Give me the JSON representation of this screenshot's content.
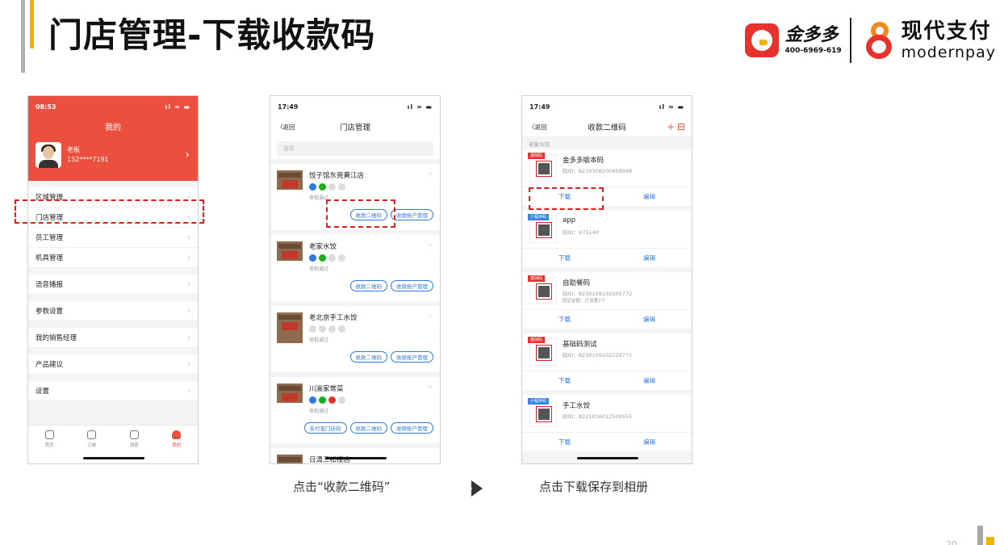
{
  "slide": {
    "title": "门店管理-下载收款码",
    "page_number": "20"
  },
  "brand": {
    "jdd_name": "金多多",
    "jdd_phone": "400-6969-619",
    "mp_cn": "现代支付",
    "mp_en": "modernpay"
  },
  "phone_me": {
    "time": "08:53",
    "sys": "ıl ≈ ▬",
    "title": "我的",
    "user_name": "老板",
    "user_phone": "152****7191",
    "menu": [
      "区域管理",
      "门店管理",
      "员工管理",
      "机具管理",
      "语音播报",
      "参数设置",
      "我的销售经理",
      "产品建议",
      "设置"
    ],
    "tabs": [
      "首页",
      "订单",
      "消息",
      "我的"
    ]
  },
  "phone_stores": {
    "time": "17:49",
    "sys": "ıl ≈ ▬",
    "back": "〈返回",
    "title": "门店管理",
    "search_placeholder": "搜索",
    "stores": [
      {
        "name": "饺子馆东莞黄江店",
        "status": "审批通过",
        "btn_qr": "收款二维码",
        "btn_account": "收款账户管理"
      },
      {
        "name": "老家水饺",
        "status": "审批通过",
        "btn_qr": "收款二维码",
        "btn_account": "收款账户管理"
      },
      {
        "name": "老北京手工水饺",
        "status": "审批通过",
        "btn_qr": "收款二维码",
        "btn_account": "收款账户管理"
      },
      {
        "name": "川渝家常菜",
        "status": "审批通过",
        "btn_alipay": "支付宝门店码",
        "btn_qr": "收款二维码",
        "btn_account": "收款账户管理"
      },
      {
        "name": "日清三松楼店"
      }
    ]
  },
  "phone_qr": {
    "time": "17:49",
    "sys": "ıl ≈ ▬",
    "back": "〈返回",
    "title": "收款二维码",
    "plus": "+",
    "scan": "⊟",
    "section": "老家水饺",
    "cards": [
      {
        "tag": "基础码",
        "name": "金多多版本码",
        "id": "码ID：8230308100458948",
        "extra": "",
        "download": "下载",
        "edit": "编辑"
      },
      {
        "tag": "小程序码",
        "name": "app",
        "id": "码ID：X75140",
        "extra": "",
        "download": "下载",
        "edit": "编辑"
      },
      {
        "tag": "基础码",
        "name": "自助餐码",
        "id": "码ID：8230109135505772",
        "extra": "固定金额：已设置2个",
        "download": "下载",
        "edit": "编辑"
      },
      {
        "tag": "基础码",
        "name": "基础码测试",
        "id": "码ID：8230109102229771",
        "extra": "",
        "download": "下载",
        "edit": "编辑"
      },
      {
        "tag": "小程序码",
        "name": "手工水饺",
        "id": "码ID：8221016012509555",
        "extra": "",
        "download": "下载",
        "edit": "编辑"
      }
    ]
  },
  "captions": {
    "step2": "点击“收款二维码”",
    "step3": "点击下载保存到相册"
  },
  "colors": {
    "accent_red": "#ec4f3d",
    "link_blue": "#2d7ae0",
    "title_bar_yellow": "#f2b100",
    "highlight": "#e02020"
  }
}
